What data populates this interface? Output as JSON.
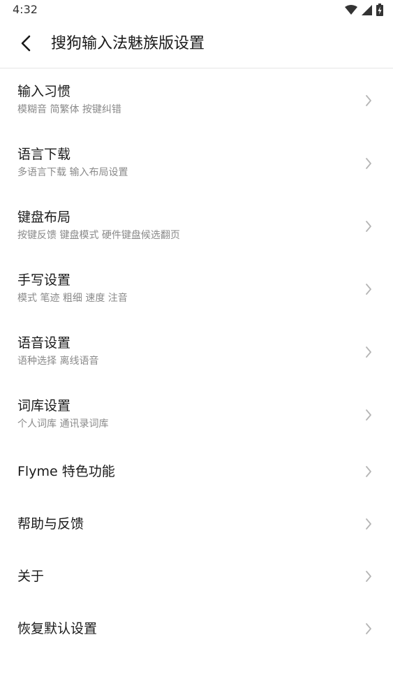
{
  "status_bar": {
    "time": "4:32",
    "icons": [
      "wifi-icon",
      "cellular-signal-icon",
      "battery-charging-icon"
    ]
  },
  "header": {
    "back_icon": "chevron-left-icon",
    "title": "搜狗输入法魅族版设置"
  },
  "colors": {
    "background": "#ffffff",
    "title_text": "#1a1a1a",
    "subtitle_text": "#8a8a8a",
    "chevron": "#b5b5b5",
    "divider": "#e6e6e6"
  },
  "settings": {
    "items": [
      {
        "title": "输入习惯",
        "subtitle": "模糊音 简繁体 按键纠错"
      },
      {
        "title": "语言下载",
        "subtitle": "多语言下载 输入布局设置"
      },
      {
        "title": "键盘布局",
        "subtitle": "按键反馈 键盘模式 硬件键盘候选翻页"
      },
      {
        "title": "手写设置",
        "subtitle": "模式 笔迹 粗细 速度 注音"
      },
      {
        "title": "语音设置",
        "subtitle": "语种选择 离线语音"
      },
      {
        "title": "词库设置",
        "subtitle": "个人词库 通讯录词库"
      },
      {
        "title": "Flyme 特色功能"
      },
      {
        "title": "帮助与反馈"
      },
      {
        "title": "关于"
      },
      {
        "title": "恢复默认设置"
      }
    ],
    "chevron_icon": "chevron-right-icon"
  }
}
